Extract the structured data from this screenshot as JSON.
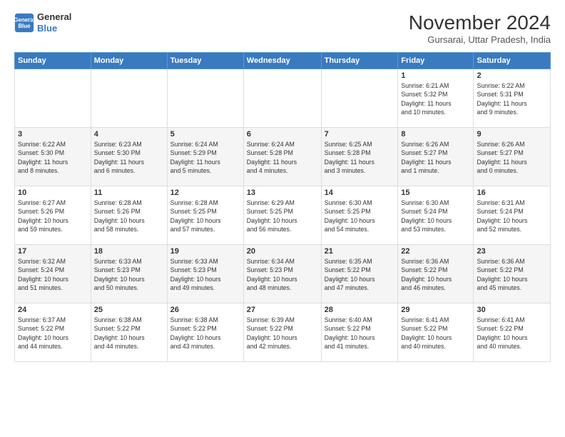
{
  "logo": {
    "line1": "General",
    "line2": "Blue"
  },
  "title": "November 2024",
  "subtitle": "Gursarai, Uttar Pradesh, India",
  "header_days": [
    "Sunday",
    "Monday",
    "Tuesday",
    "Wednesday",
    "Thursday",
    "Friday",
    "Saturday"
  ],
  "weeks": [
    [
      {
        "day": "",
        "info": ""
      },
      {
        "day": "",
        "info": ""
      },
      {
        "day": "",
        "info": ""
      },
      {
        "day": "",
        "info": ""
      },
      {
        "day": "",
        "info": ""
      },
      {
        "day": "1",
        "info": "Sunrise: 6:21 AM\nSunset: 5:32 PM\nDaylight: 11 hours\nand 10 minutes."
      },
      {
        "day": "2",
        "info": "Sunrise: 6:22 AM\nSunset: 5:31 PM\nDaylight: 11 hours\nand 9 minutes."
      }
    ],
    [
      {
        "day": "3",
        "info": "Sunrise: 6:22 AM\nSunset: 5:30 PM\nDaylight: 11 hours\nand 8 minutes."
      },
      {
        "day": "4",
        "info": "Sunrise: 6:23 AM\nSunset: 5:30 PM\nDaylight: 11 hours\nand 6 minutes."
      },
      {
        "day": "5",
        "info": "Sunrise: 6:24 AM\nSunset: 5:29 PM\nDaylight: 11 hours\nand 5 minutes."
      },
      {
        "day": "6",
        "info": "Sunrise: 6:24 AM\nSunset: 5:28 PM\nDaylight: 11 hours\nand 4 minutes."
      },
      {
        "day": "7",
        "info": "Sunrise: 6:25 AM\nSunset: 5:28 PM\nDaylight: 11 hours\nand 3 minutes."
      },
      {
        "day": "8",
        "info": "Sunrise: 6:26 AM\nSunset: 5:27 PM\nDaylight: 11 hours\nand 1 minute."
      },
      {
        "day": "9",
        "info": "Sunrise: 6:26 AM\nSunset: 5:27 PM\nDaylight: 11 hours\nand 0 minutes."
      }
    ],
    [
      {
        "day": "10",
        "info": "Sunrise: 6:27 AM\nSunset: 5:26 PM\nDaylight: 10 hours\nand 59 minutes."
      },
      {
        "day": "11",
        "info": "Sunrise: 6:28 AM\nSunset: 5:26 PM\nDaylight: 10 hours\nand 58 minutes."
      },
      {
        "day": "12",
        "info": "Sunrise: 6:28 AM\nSunset: 5:25 PM\nDaylight: 10 hours\nand 57 minutes."
      },
      {
        "day": "13",
        "info": "Sunrise: 6:29 AM\nSunset: 5:25 PM\nDaylight: 10 hours\nand 56 minutes."
      },
      {
        "day": "14",
        "info": "Sunrise: 6:30 AM\nSunset: 5:25 PM\nDaylight: 10 hours\nand 54 minutes."
      },
      {
        "day": "15",
        "info": "Sunrise: 6:30 AM\nSunset: 5:24 PM\nDaylight: 10 hours\nand 53 minutes."
      },
      {
        "day": "16",
        "info": "Sunrise: 6:31 AM\nSunset: 5:24 PM\nDaylight: 10 hours\nand 52 minutes."
      }
    ],
    [
      {
        "day": "17",
        "info": "Sunrise: 6:32 AM\nSunset: 5:24 PM\nDaylight: 10 hours\nand 51 minutes."
      },
      {
        "day": "18",
        "info": "Sunrise: 6:33 AM\nSunset: 5:23 PM\nDaylight: 10 hours\nand 50 minutes."
      },
      {
        "day": "19",
        "info": "Sunrise: 6:33 AM\nSunset: 5:23 PM\nDaylight: 10 hours\nand 49 minutes."
      },
      {
        "day": "20",
        "info": "Sunrise: 6:34 AM\nSunset: 5:23 PM\nDaylight: 10 hours\nand 48 minutes."
      },
      {
        "day": "21",
        "info": "Sunrise: 6:35 AM\nSunset: 5:22 PM\nDaylight: 10 hours\nand 47 minutes."
      },
      {
        "day": "22",
        "info": "Sunrise: 6:36 AM\nSunset: 5:22 PM\nDaylight: 10 hours\nand 46 minutes."
      },
      {
        "day": "23",
        "info": "Sunrise: 6:36 AM\nSunset: 5:22 PM\nDaylight: 10 hours\nand 45 minutes."
      }
    ],
    [
      {
        "day": "24",
        "info": "Sunrise: 6:37 AM\nSunset: 5:22 PM\nDaylight: 10 hours\nand 44 minutes."
      },
      {
        "day": "25",
        "info": "Sunrise: 6:38 AM\nSunset: 5:22 PM\nDaylight: 10 hours\nand 44 minutes."
      },
      {
        "day": "26",
        "info": "Sunrise: 6:38 AM\nSunset: 5:22 PM\nDaylight: 10 hours\nand 43 minutes."
      },
      {
        "day": "27",
        "info": "Sunrise: 6:39 AM\nSunset: 5:22 PM\nDaylight: 10 hours\nand 42 minutes."
      },
      {
        "day": "28",
        "info": "Sunrise: 6:40 AM\nSunset: 5:22 PM\nDaylight: 10 hours\nand 41 minutes."
      },
      {
        "day": "29",
        "info": "Sunrise: 6:41 AM\nSunset: 5:22 PM\nDaylight: 10 hours\nand 40 minutes."
      },
      {
        "day": "30",
        "info": "Sunrise: 6:41 AM\nSunset: 5:22 PM\nDaylight: 10 hours\nand 40 minutes."
      }
    ]
  ]
}
